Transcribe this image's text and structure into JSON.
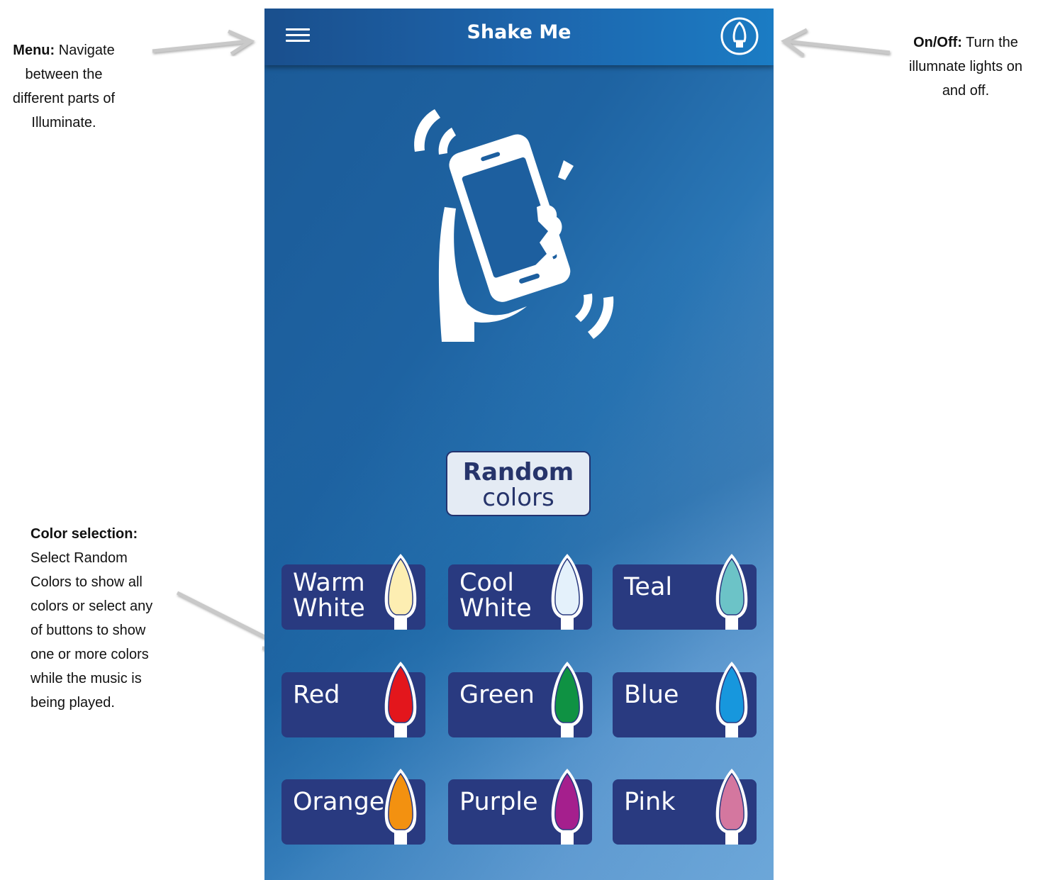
{
  "annotations": {
    "menu": {
      "title": "Menu:",
      "line1": "Navigate",
      "line2": "between the",
      "line3": "different parts of",
      "line4": "Illuminate."
    },
    "onoff": {
      "title": "On/Off:",
      "line1": "Turn the",
      "line2": "illumnate lights on",
      "line3": "and off."
    },
    "color": {
      "title": "Color selection:",
      "line1": "Select Random",
      "line2": "Colors to show all",
      "line3": "colors or select any",
      "line4": "of buttons to show",
      "line5": "one or more colors",
      "line6": "while the music is",
      "line7": "being played."
    }
  },
  "header": {
    "title": "Shake Me",
    "menu_icon": "hamburger-menu-icon",
    "power_icon": "bulb-power-icon"
  },
  "random": {
    "line1": "Random",
    "line2": "colors"
  },
  "colors": [
    {
      "line1": "Warm",
      "line2": "White",
      "fill": "#fdeeb2"
    },
    {
      "line1": "Cool",
      "line2": "White",
      "fill": "#e4f1fb"
    },
    {
      "line1": "Teal",
      "line2": "",
      "fill": "#6cc3c7"
    },
    {
      "line1": "Red",
      "line2": "",
      "fill": "#e3161c"
    },
    {
      "line1": "Green",
      "line2": "",
      "fill": "#0f9243"
    },
    {
      "line1": "Blue",
      "line2": "",
      "fill": "#1797dd"
    },
    {
      "line1": "Orange",
      "line2": "",
      "fill": "#f39110"
    },
    {
      "line1": "Purple",
      "line2": "",
      "fill": "#a51f8d"
    },
    {
      "line1": "Pink",
      "line2": "",
      "fill": "#d4779f"
    }
  ]
}
